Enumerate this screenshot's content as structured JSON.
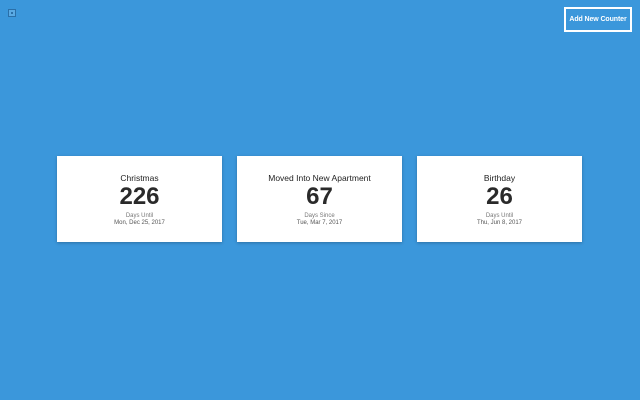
{
  "header": {
    "corner_icon": "app-icon",
    "add_button_label": "Add New Counter"
  },
  "counters": [
    {
      "title": "Christmas",
      "count": "226",
      "label": "Days Until",
      "date": "Mon, Dec 25, 2017"
    },
    {
      "title": "Moved Into New Apartment",
      "count": "67",
      "label": "Days Since",
      "date": "Tue, Mar 7, 2017"
    },
    {
      "title": "Birthday",
      "count": "26",
      "label": "Days Until",
      "date": "Thu, Jun 8, 2017"
    }
  ],
  "colors": {
    "background": "#3b97db",
    "card": "#ffffff",
    "button_border": "#ffffff"
  }
}
